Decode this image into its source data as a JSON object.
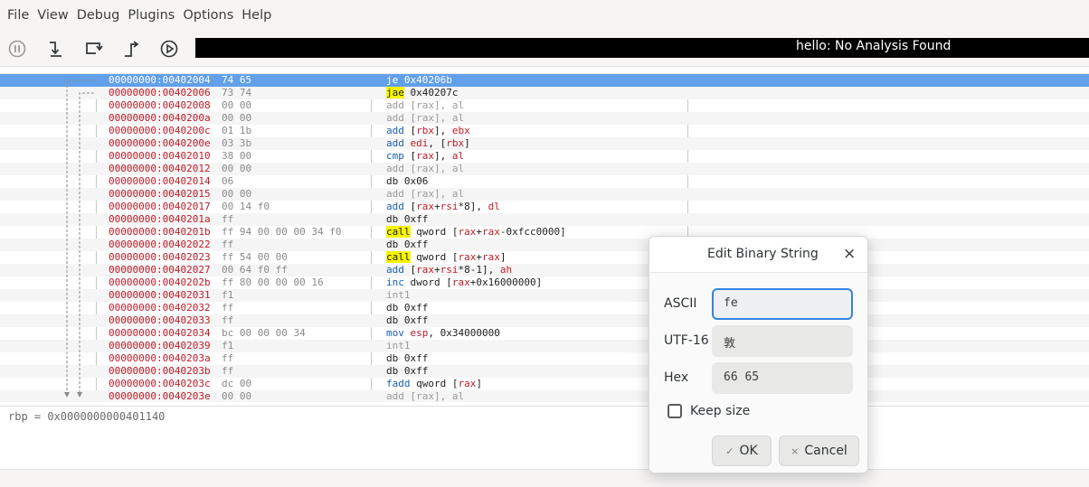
{
  "menu": [
    "File",
    "View",
    "Debug",
    "Plugins",
    "Options",
    "Help"
  ],
  "toolbar": {
    "buttons": [
      {
        "name": "pause-icon"
      },
      {
        "name": "step-into-icon"
      },
      {
        "name": "step-over-icon"
      },
      {
        "name": "step-out-icon"
      },
      {
        "name": "run-icon"
      }
    ],
    "status": "hello: No Analysis Found"
  },
  "disasm": {
    "rows": [
      {
        "addr": "00000000:00402004",
        "bytes": "74 65",
        "mn": "je",
        "mnstyle": "gray",
        "ops": [
          {
            "t": "0x40206b",
            "s": "gray"
          }
        ],
        "selected": true
      },
      {
        "addr": "00000000:00402006",
        "bytes": "73 74",
        "mn": "jae",
        "mnstyle": "hl",
        "ops": [
          {
            "t": "0x40207c",
            "s": "dark"
          }
        ]
      },
      {
        "addr": "00000000:00402008",
        "bytes": "00 00",
        "mn": "add",
        "mnstyle": "gray",
        "ops": [
          {
            "t": "[rax], al",
            "s": "gray"
          }
        ]
      },
      {
        "addr": "00000000:0040200a",
        "bytes": "00 00",
        "mn": "add",
        "mnstyle": "gray",
        "ops": [
          {
            "t": "[rax], al",
            "s": "gray"
          }
        ]
      },
      {
        "addr": "00000000:0040200c",
        "bytes": "01 1b",
        "mn": "add",
        "mnstyle": "blue",
        "ops": [
          {
            "t": "[",
            "s": "dark"
          },
          {
            "t": "rbx",
            "s": "reg"
          },
          {
            "t": "], ",
            "s": "dark"
          },
          {
            "t": "ebx",
            "s": "reg"
          }
        ]
      },
      {
        "addr": "00000000:0040200e",
        "bytes": "03 3b",
        "mn": "add",
        "mnstyle": "blue",
        "ops": [
          {
            "t": "edi",
            "s": "reg"
          },
          {
            "t": ", [",
            "s": "dark"
          },
          {
            "t": "rbx",
            "s": "reg"
          },
          {
            "t": "]",
            "s": "dark"
          }
        ]
      },
      {
        "addr": "00000000:00402010",
        "bytes": "38 00",
        "mn": "cmp",
        "mnstyle": "blue",
        "ops": [
          {
            "t": "[",
            "s": "dark"
          },
          {
            "t": "rax",
            "s": "reg"
          },
          {
            "t": "], ",
            "s": "dark"
          },
          {
            "t": "al",
            "s": "reg"
          }
        ]
      },
      {
        "addr": "00000000:00402012",
        "bytes": "00 00",
        "mn": "add",
        "mnstyle": "gray",
        "ops": [
          {
            "t": "[rax], al",
            "s": "gray"
          }
        ]
      },
      {
        "addr": "00000000:00402014",
        "bytes": "06",
        "mn": "db",
        "mnstyle": "black",
        "ops": [
          {
            "t": "0x06",
            "s": "dark"
          }
        ]
      },
      {
        "addr": "00000000:00402015",
        "bytes": "00 00",
        "mn": "add",
        "mnstyle": "gray",
        "ops": [
          {
            "t": "[rax], al",
            "s": "gray"
          }
        ]
      },
      {
        "addr": "00000000:00402017",
        "bytes": "00 14 f0",
        "mn": "add",
        "mnstyle": "blue",
        "ops": [
          {
            "t": "[",
            "s": "dark"
          },
          {
            "t": "rax",
            "s": "reg"
          },
          {
            "t": "+",
            "s": "dark"
          },
          {
            "t": "rsi",
            "s": "reg"
          },
          {
            "t": "*8], ",
            "s": "dark"
          },
          {
            "t": "dl",
            "s": "reg"
          }
        ]
      },
      {
        "addr": "00000000:0040201a",
        "bytes": "ff",
        "mn": "db",
        "mnstyle": "black",
        "ops": [
          {
            "t": "0xff",
            "s": "dark"
          }
        ]
      },
      {
        "addr": "00000000:0040201b",
        "bytes": "ff 94 00 00 00 34 f0",
        "mn": "call",
        "mnstyle": "hl",
        "ops": [
          {
            "t": "qword [",
            "s": "dark"
          },
          {
            "t": "rax",
            "s": "reg"
          },
          {
            "t": "+",
            "s": "dark"
          },
          {
            "t": "rax",
            "s": "reg"
          },
          {
            "t": "-0xfcc0000]",
            "s": "dark"
          }
        ]
      },
      {
        "addr": "00000000:00402022",
        "bytes": "ff",
        "mn": "db",
        "mnstyle": "black",
        "ops": [
          {
            "t": "0xff",
            "s": "dark"
          }
        ]
      },
      {
        "addr": "00000000:00402023",
        "bytes": "ff 54 00 00",
        "mn": "call",
        "mnstyle": "hl",
        "ops": [
          {
            "t": "qword [",
            "s": "dark"
          },
          {
            "t": "rax",
            "s": "reg"
          },
          {
            "t": "+",
            "s": "dark"
          },
          {
            "t": "rax",
            "s": "reg"
          },
          {
            "t": "]",
            "s": "dark"
          }
        ]
      },
      {
        "addr": "00000000:00402027",
        "bytes": "00 64 f0 ff",
        "mn": "add",
        "mnstyle": "blue",
        "ops": [
          {
            "t": "[",
            "s": "dark"
          },
          {
            "t": "rax",
            "s": "reg"
          },
          {
            "t": "+",
            "s": "dark"
          },
          {
            "t": "rsi",
            "s": "reg"
          },
          {
            "t": "*8-1], ",
            "s": "dark"
          },
          {
            "t": "ah",
            "s": "reg"
          }
        ]
      },
      {
        "addr": "00000000:0040202b",
        "bytes": "ff 80 00 00 00 16",
        "mn": "inc",
        "mnstyle": "blue",
        "ops": [
          {
            "t": "dword [",
            "s": "dark"
          },
          {
            "t": "rax",
            "s": "reg"
          },
          {
            "t": "+0x16000000]",
            "s": "dark"
          }
        ]
      },
      {
        "addr": "00000000:00402031",
        "bytes": "f1",
        "mn": "int1",
        "mnstyle": "gray",
        "ops": []
      },
      {
        "addr": "00000000:00402032",
        "bytes": "ff",
        "mn": "db",
        "mnstyle": "black",
        "ops": [
          {
            "t": "0xff",
            "s": "dark"
          }
        ]
      },
      {
        "addr": "00000000:00402033",
        "bytes": "ff",
        "mn": "db",
        "mnstyle": "black",
        "ops": [
          {
            "t": "0xff",
            "s": "dark"
          }
        ]
      },
      {
        "addr": "00000000:00402034",
        "bytes": "bc 00 00 00 34",
        "mn": "mov",
        "mnstyle": "blue",
        "ops": [
          {
            "t": "esp",
            "s": "reg"
          },
          {
            "t": ", 0x34000000",
            "s": "dark"
          }
        ]
      },
      {
        "addr": "00000000:00402039",
        "bytes": "f1",
        "mn": "int1",
        "mnstyle": "gray",
        "ops": []
      },
      {
        "addr": "00000000:0040203a",
        "bytes": "ff",
        "mn": "db",
        "mnstyle": "black",
        "ops": [
          {
            "t": "0xff",
            "s": "dark"
          }
        ]
      },
      {
        "addr": "00000000:0040203b",
        "bytes": "ff",
        "mn": "db",
        "mnstyle": "black",
        "ops": [
          {
            "t": "0xff",
            "s": "dark"
          }
        ]
      },
      {
        "addr": "00000000:0040203c",
        "bytes": "dc 00",
        "mn": "fadd",
        "mnstyle": "blue",
        "ops": [
          {
            "t": "qword [",
            "s": "dark"
          },
          {
            "t": "rax",
            "s": "reg"
          },
          {
            "t": "]",
            "s": "dark"
          }
        ]
      },
      {
        "addr": "00000000:0040203e",
        "bytes": "00 00",
        "mn": "add",
        "mnstyle": "gray",
        "ops": [
          {
            "t": "[rax], al",
            "s": "gray"
          }
        ]
      }
    ]
  },
  "registers": {
    "line": "rbp = 0x0000000000401140"
  },
  "dialog": {
    "title": "Edit Binary String",
    "close": "×",
    "ascii_label": "ASCII",
    "ascii_value": "fe",
    "utf16_label": "UTF-16",
    "utf16_value": "敦",
    "hex_label": "Hex",
    "hex_value": "66 65",
    "keep_size_label": "Keep size",
    "keep_size_checked": false,
    "ok_label": "OK",
    "ok_icon": "✓",
    "cancel_label": "Cancel",
    "cancel_icon": "×"
  }
}
